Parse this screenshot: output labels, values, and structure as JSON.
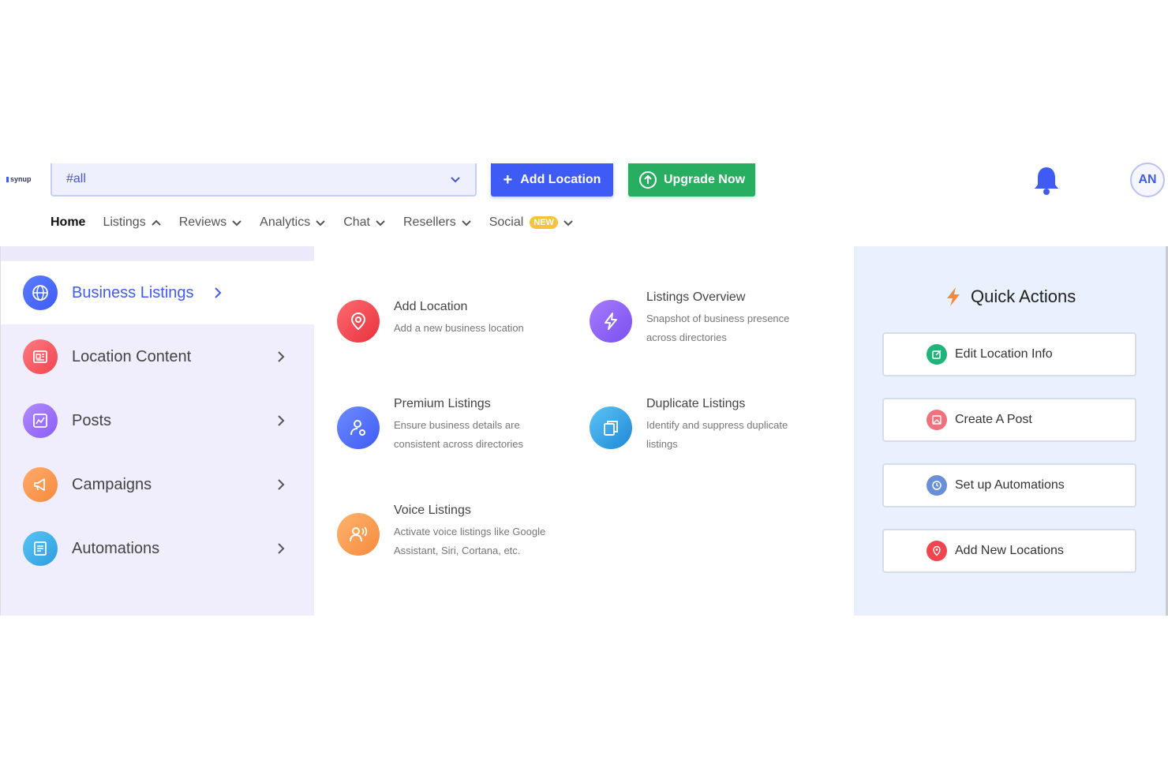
{
  "brand": {
    "logo_text": "synup"
  },
  "header": {
    "location_select": {
      "value": "#all"
    },
    "add_location_label": "Add Location",
    "upgrade_label": "Upgrade Now",
    "avatar_initials": "AN"
  },
  "nav": {
    "items": [
      {
        "label": "Home"
      },
      {
        "label": "Listings"
      },
      {
        "label": "Reviews"
      },
      {
        "label": "Analytics"
      },
      {
        "label": "Chat"
      },
      {
        "label": "Resellers"
      },
      {
        "label": "Social",
        "badge": "NEW"
      }
    ]
  },
  "menu": {
    "categories": [
      {
        "label": "Business Listings",
        "icon": "globe-icon",
        "color": "#3f5bf5",
        "active": true
      },
      {
        "label": "Location Content",
        "icon": "document-icon",
        "color": "#f0454f"
      },
      {
        "label": "Posts",
        "icon": "chart-icon",
        "color": "#8b5cf6"
      },
      {
        "label": "Campaigns",
        "icon": "megaphone-icon",
        "color": "#f68a3c"
      },
      {
        "label": "Automations",
        "icon": "list-icon",
        "color": "#2a9de0"
      }
    ],
    "items": [
      {
        "title": "Add Location",
        "desc": "Add a new business location",
        "icon": "location-pin-icon",
        "color": "#f0454f"
      },
      {
        "title": "Listings Overview",
        "desc": "Snapshot of business presence across directories",
        "icon": "lightning-icon",
        "color": "#8b5cf6"
      },
      {
        "title": "Premium Listings",
        "desc": "Ensure business details are consistent across directories",
        "icon": "user-pin-icon",
        "color": "#4b6af2"
      },
      {
        "title": "Duplicate Listings",
        "desc": "Identify and suppress duplicate listings",
        "icon": "copy-icon",
        "color": "#2a9de0"
      },
      {
        "title": "Voice Listings",
        "desc": "Activate voice listings like Google Assistant, Siri, Cortana, etc.",
        "icon": "voice-icon",
        "color": "#f68a3c"
      }
    ]
  },
  "quick_actions": {
    "title": "Quick Actions",
    "buttons": [
      {
        "label": "Edit Location Info",
        "icon": "edit-icon",
        "color": "#1fb57a"
      },
      {
        "label": "Create A Post",
        "icon": "image-icon",
        "color": "#f0727d"
      },
      {
        "label": "Set up Automations",
        "icon": "clock-icon",
        "color": "#6b8fd6"
      },
      {
        "label": "Add New Locations",
        "icon": "location-pin-icon",
        "color": "#f0454f"
      }
    ]
  }
}
